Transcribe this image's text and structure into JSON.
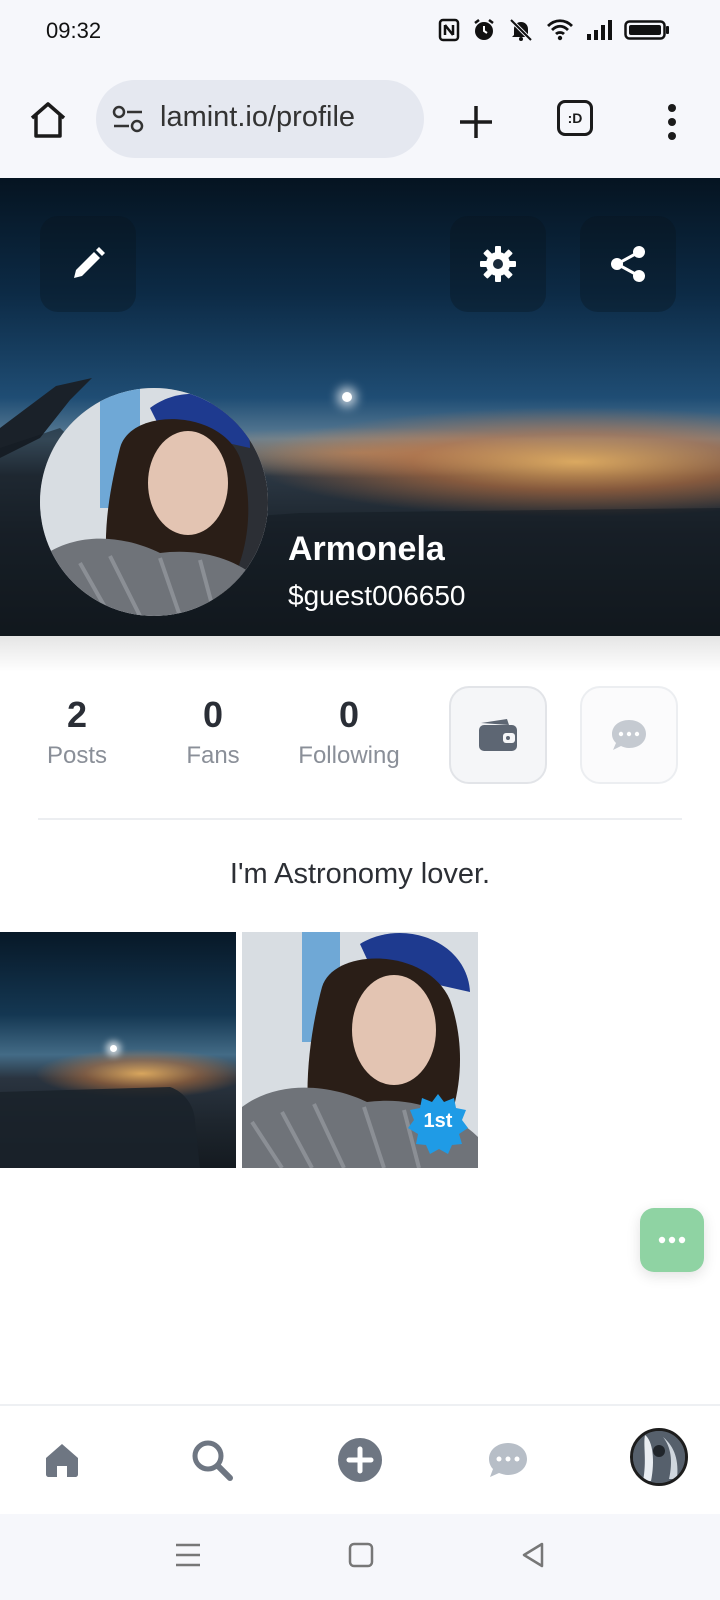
{
  "status_bar": {
    "time": "09:32",
    "icons": [
      "nfc-icon",
      "alarm-icon",
      "mute-icon",
      "wifi-icon",
      "signal-icon",
      "battery-icon"
    ]
  },
  "browser": {
    "url": "lamint.io/profile",
    "tab_count_label": ":D"
  },
  "profile": {
    "name": "Armonela",
    "handle": "$guest006650",
    "bio": "I'm Astronomy lover."
  },
  "stats": [
    {
      "value": "2",
      "label": "Posts"
    },
    {
      "value": "0",
      "label": "Fans"
    },
    {
      "value": "0",
      "label": "Following"
    }
  ],
  "posts": [
    {
      "type": "image",
      "subject": "sunset-over-clouds"
    },
    {
      "type": "image",
      "subject": "selfie",
      "badge": "1st"
    }
  ],
  "colors": {
    "accent_green": "#8fd3a3",
    "badge_blue": "#1f9be6",
    "icon_gray": "#6e7682"
  }
}
